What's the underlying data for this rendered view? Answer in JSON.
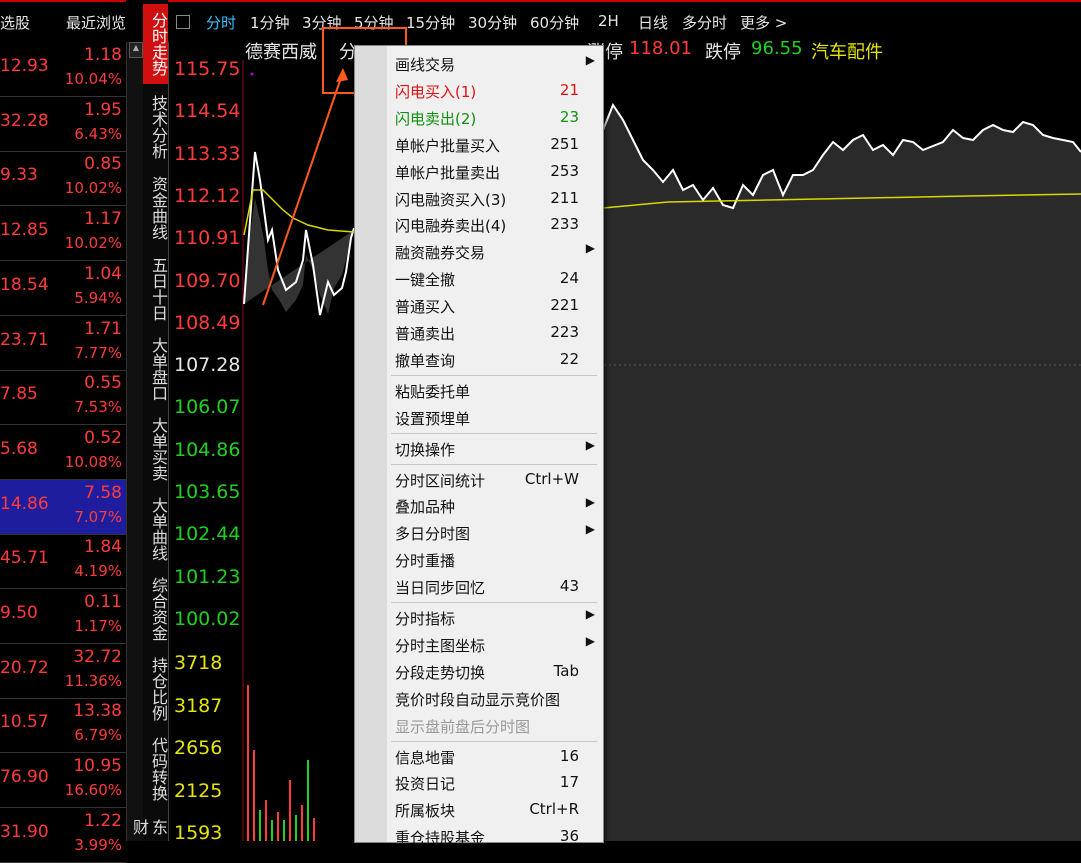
{
  "watchlist": {
    "header_left": "选股",
    "header_right": "最近浏览",
    "rows": [
      {
        "price": "12.93",
        "chg": "1.18",
        "pct": "10.04%"
      },
      {
        "price": "32.28",
        "chg": "1.95",
        "pct": "6.43%"
      },
      {
        "price": "9.33",
        "chg": "0.85",
        "pct": "10.02%"
      },
      {
        "price": "12.85",
        "chg": "1.17",
        "pct": "10.02%"
      },
      {
        "price": "18.54",
        "chg": "1.04",
        "pct": "5.94%"
      },
      {
        "price": "23.71",
        "chg": "1.71",
        "pct": "7.77%"
      },
      {
        "price": "7.85",
        "chg": "0.55",
        "pct": "7.53%"
      },
      {
        "price": "5.68",
        "chg": "0.52",
        "pct": "10.08%"
      },
      {
        "price": "14.86",
        "chg": "7.58",
        "pct": "7.07%"
      },
      {
        "price": "45.71",
        "chg": "1.84",
        "pct": "4.19%"
      },
      {
        "price": "9.50",
        "chg": "0.11",
        "pct": "1.17%"
      },
      {
        "price": "20.72",
        "chg": "32.72",
        "pct": "11.36%"
      },
      {
        "price": "10.57",
        "chg": "13.38",
        "pct": "6.79%"
      },
      {
        "price": "76.90",
        "chg": "10.95",
        "pct": "16.60%"
      },
      {
        "price": "31.90",
        "chg": "1.22",
        "pct": "3.99%"
      }
    ]
  },
  "vtabs": [
    "分时走势",
    "技术分析",
    "资金曲线",
    "五日十日",
    "大单盘口",
    "大单买卖",
    "大单曲线",
    "综合资金",
    "持仓比例",
    "代码转换",
    "东财"
  ],
  "topbar": {
    "items": [
      "分时",
      "1分钟",
      "3分钟",
      "5分钟",
      "15分钟",
      "30分钟",
      "60分钟",
      "2H",
      "日线",
      "多分时",
      "更多 >"
    ]
  },
  "stock": {
    "name": "德赛西威",
    "fenshi": "分",
    "limit_up_label": "涨停",
    "limit_up_value": "118.01",
    "limit_down_label": "跌停",
    "limit_down_value": "96.55",
    "sector": "汽车配件"
  },
  "chart": {
    "price_ticks": [
      "115.75",
      "114.54",
      "113.33",
      "112.12",
      "110.91",
      "109.70",
      "108.49",
      "107.28",
      "106.07",
      "104.86",
      "103.65",
      "102.44",
      "101.23",
      "100.02"
    ],
    "volume_ticks": [
      "3718",
      "3187",
      "2656",
      "2125",
      "1593"
    ],
    "colors": {
      "up": "#ff3b3b",
      "down": "#20d020",
      "neutral": "#e6e6e6",
      "avg_line": "#e6e600"
    }
  },
  "menu": {
    "items": [
      {
        "label": "画线交易",
        "key": "",
        "submenu": true
      },
      {
        "label": "闪电买入(1)",
        "key": "21",
        "color": "red"
      },
      {
        "label": "闪电卖出(2)",
        "key": "23",
        "color": "green"
      },
      {
        "label": "单帐户批量买入",
        "key": "251"
      },
      {
        "label": "单帐户批量卖出",
        "key": "253"
      },
      {
        "label": "闪电融资买入(3)",
        "key": "211"
      },
      {
        "label": "闪电融券卖出(4)",
        "key": "233"
      },
      {
        "label": "融资融券交易",
        "key": "",
        "submenu": true
      },
      {
        "label": "一键全撤",
        "key": "24"
      },
      {
        "label": "普通买入",
        "key": "221"
      },
      {
        "label": "普通卖出",
        "key": "223"
      },
      {
        "label": "撤单查询",
        "key": "22"
      },
      {
        "label": "粘贴委托单",
        "key": ""
      },
      {
        "label": "设置预埋单",
        "key": ""
      },
      {
        "label": "切换操作",
        "key": "",
        "submenu": true
      },
      {
        "label": "分时区间统计",
        "key": "Ctrl+W"
      },
      {
        "label": "叠加品种",
        "key": "",
        "submenu": true
      },
      {
        "label": "多日分时图",
        "key": "",
        "submenu": true
      },
      {
        "label": "分时重播",
        "key": ""
      },
      {
        "label": "当日同步回忆",
        "key": "43"
      },
      {
        "label": "分时指标",
        "key": "",
        "submenu": true
      },
      {
        "label": "分时主图坐标",
        "key": "",
        "submenu": true
      },
      {
        "label": "分段走势切换",
        "key": "Tab"
      },
      {
        "label": "竞价时段自动显示竞价图",
        "key": ""
      },
      {
        "label": "显示盘前盘后分时图",
        "key": "",
        "disabled": true
      },
      {
        "label": "信息地雷",
        "key": "16"
      },
      {
        "label": "投资日记",
        "key": "17"
      },
      {
        "label": "所属板块",
        "key": "Ctrl+R"
      },
      {
        "label": "重仓持股基金",
        "key": "36"
      }
    ]
  }
}
